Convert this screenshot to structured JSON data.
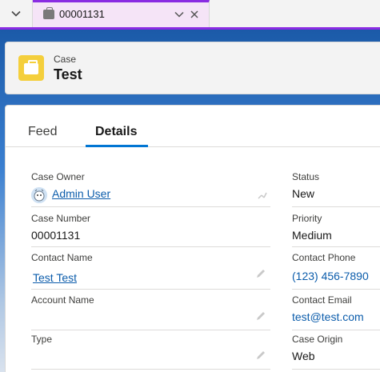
{
  "tab": {
    "label": "00001131"
  },
  "header": {
    "object_label": "Case",
    "record_title": "Test"
  },
  "record_tabs": {
    "feed": "Feed",
    "details": "Details"
  },
  "fields": {
    "case_owner": {
      "label": "Case Owner",
      "value": "Admin User"
    },
    "status": {
      "label": "Status",
      "value": "New"
    },
    "case_number": {
      "label": "Case Number",
      "value": "00001131"
    },
    "priority": {
      "label": "Priority",
      "value": "Medium"
    },
    "contact_name": {
      "label": "Contact Name",
      "value": "Test Test"
    },
    "contact_phone": {
      "label": "Contact Phone",
      "value": "(123) 456-7890"
    },
    "account_name": {
      "label": "Account Name",
      "value": ""
    },
    "contact_email": {
      "label": "Contact Email",
      "value": "test@test.com"
    },
    "type": {
      "label": "Type",
      "value": ""
    },
    "case_origin": {
      "label": "Case Origin",
      "value": "Web"
    }
  },
  "colors": {
    "accent": "#8a2be2",
    "link": "#0b5cab",
    "active_tab": "#0176d3",
    "case_icon": "#f4cf3c"
  },
  "icons": {
    "tab_menu": "chevron-down-icon",
    "tab_object": "case-icon",
    "tab_menu_chevron": "chevron-down-icon",
    "tab_close": "close-icon",
    "header_object": "case-icon",
    "owner_avatar": "user-avatar-icon",
    "change_owner": "change-owner-icon",
    "edit": "pencil-icon"
  }
}
